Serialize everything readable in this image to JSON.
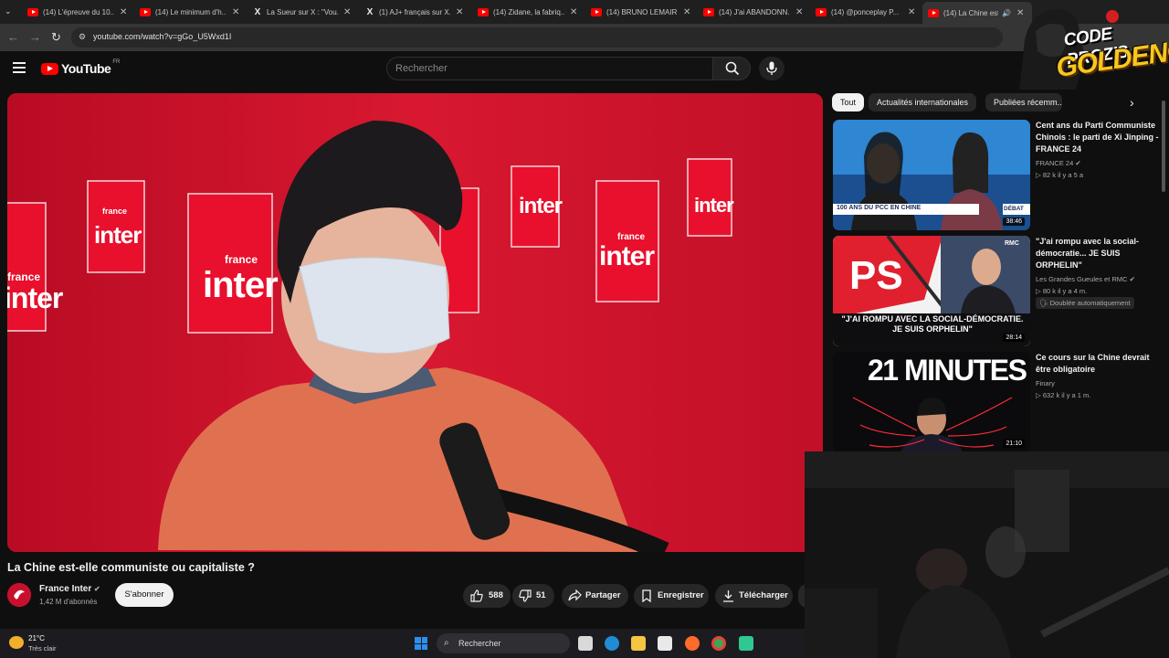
{
  "browser": {
    "tabs": [
      {
        "title": "(14) L'épreuve du 10...",
        "favicon": "youtube-icon",
        "active": false
      },
      {
        "title": "(14) Le minimum d'h...",
        "favicon": "youtube-icon",
        "active": false
      },
      {
        "title": "La Sueur sur X : \"Vou...",
        "favicon": "x-icon",
        "active": false
      },
      {
        "title": "(1) AJ+ français sur X...",
        "favicon": "x-icon",
        "active": false
      },
      {
        "title": "(14) Zidane, la fabriq...",
        "favicon": "youtube-icon",
        "active": false
      },
      {
        "title": "(14) BRUNO LEMAIR...",
        "favicon": "youtube-icon",
        "active": false
      },
      {
        "title": "(14) J'ai ABANDONN...",
        "favicon": "youtube-icon",
        "active": false
      },
      {
        "title": "(14) @ponceplay P...",
        "favicon": "youtube-icon",
        "active": false
      },
      {
        "title": "(14) La Chine est...",
        "favicon": "youtube-icon",
        "active": true
      }
    ],
    "url": "youtube.com/watch?v=gGo_U5Wxd1I"
  },
  "header": {
    "logo_text": "YouTube",
    "country_code": "FR",
    "search_placeholder": "Rechercher"
  },
  "chips": [
    "Tout",
    "Actualités internationales",
    "Publiées récemm..."
  ],
  "video": {
    "title": "La Chine est-elle communiste ou capitaliste ?",
    "channel": "France Inter",
    "subscribers": "1,42 M d'abonnés",
    "subscribe_label": "S'abonner",
    "backdrop_logo_small": "france",
    "backdrop_logo_big": "inter"
  },
  "actions": {
    "likes": "588",
    "dislikes": "51",
    "share": "Partager",
    "save": "Enregistrer",
    "download": "Télécharger"
  },
  "recommendations": [
    {
      "title": "Cent ans du Parti Communiste Chinois : le parti de Xi Jinping - FRANCE 24",
      "channel": "FRANCE 24",
      "meta": "82 k   il y a 5 a",
      "duration": "38:46",
      "banner": "100 ANS DU PCC EN CHINE",
      "tag": "DÉBAT",
      "extra": ""
    },
    {
      "title": "\"J'ai rompu avec la social-démocratie... JE SUIS ORPHELIN\"",
      "channel": "Les Grandes Gueules et RMC",
      "meta": "80 k   il y a 4 m.",
      "duration": "28:14",
      "banner": "\"J'AI ROMPU AVEC LA SOCIAL-DÉMOCRATIE. JE SUIS ORPHELIN\"",
      "tag": "RMC",
      "extra": "Doublée automatiquement"
    },
    {
      "title": "Ce cours sur la Chine devrait être obligatoire",
      "channel": "Finary",
      "meta": "632 k   il y a 1 m.",
      "duration": "21:10",
      "banner": "21 MINUTES",
      "tag": "",
      "extra": ""
    }
  ],
  "taskbar": {
    "temperature": "21°C",
    "weather": "Très clair",
    "search_label": "Rechercher"
  },
  "overlay": {
    "logo_line1": "CODE PROZIS",
    "logo_line2": "GOLDENG"
  },
  "colors": {
    "accent": "#ff0000",
    "studio_red": "#c8102e",
    "background": "#0f0f0f"
  }
}
